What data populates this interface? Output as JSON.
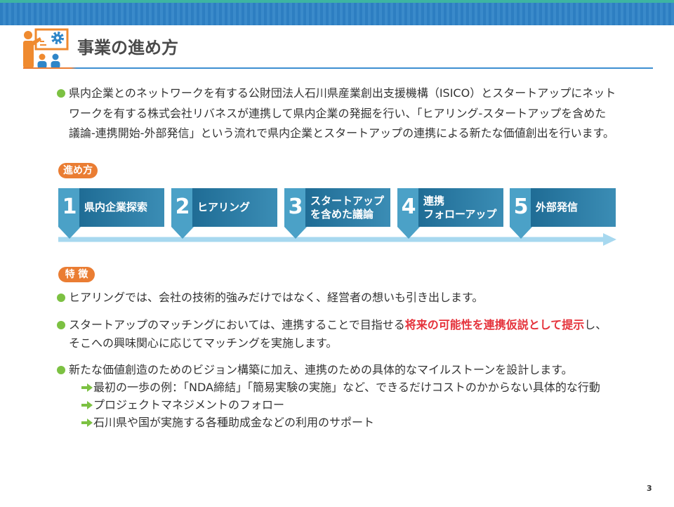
{
  "header": {
    "title": "事業の進め方",
    "icon": "presenter-gear-icon"
  },
  "intro": {
    "lines": [
      "県内企業とのネットワークを有する公財団法人石川県産業創出支援機構（ISICO）とスタートアップにネット",
      "ワークを有する株式会社リバネスが連携して県内企業の発掘を行い、「ヒアリング-スタートアップを含めた",
      "議論-連携開始-外部発信」という流れで県内企業とスタートアップの連携による新たな価値創出を行います。"
    ]
  },
  "process": {
    "label": "進め方",
    "steps": [
      {
        "number": "1",
        "lines": [
          "県内企業探索"
        ]
      },
      {
        "number": "2",
        "lines": [
          "ヒアリング"
        ]
      },
      {
        "number": "3",
        "lines": [
          "スタートアップ",
          "を含めた議論"
        ]
      },
      {
        "number": "4",
        "lines": [
          "連携",
          "フォローアップ"
        ]
      },
      {
        "number": "5",
        "lines": [
          "外部発信"
        ]
      }
    ]
  },
  "features": {
    "label": "特 徴",
    "hearing": "ヒアリングでは、会社の技術的強みだけではなく、経営者の想いも引き出します。",
    "matching": {
      "before": "スタートアップのマッチングにおいては、連携することで目指せる",
      "highlight": "将来の可能性を連携仮説として提示",
      "after": "し、",
      "line2": "そこへの興味関心に応じてマッチングを実施します。"
    },
    "vision": {
      "text": "新たな価値創造のためのビジョン構築に加え、連携のための具体的なマイルストーンを設計します。",
      "sub_items": [
        "最初の一歩の例：「NDA締結」「簡易実験の実施」など、できるだけコストのかからない具体的な行動",
        "プロジェクトマネジメントのフォロー",
        "石川県や国が実施する各種助成金などの利用のサポート"
      ]
    }
  },
  "page_number": "3",
  "icons": {
    "bullet": "bullet-dot-icon",
    "sub_bullet": "arrow-right-icon"
  },
  "colors": {
    "accent_orange": "#ea7d33",
    "bullet_green": "#7cc142",
    "highlight_red": "#e5323b",
    "step_blue": "#4ba1c7",
    "step_blue_dark": "#1f6c95",
    "flow_arrow": "#a7d8ef",
    "header_blue": "#2d7ec1"
  }
}
